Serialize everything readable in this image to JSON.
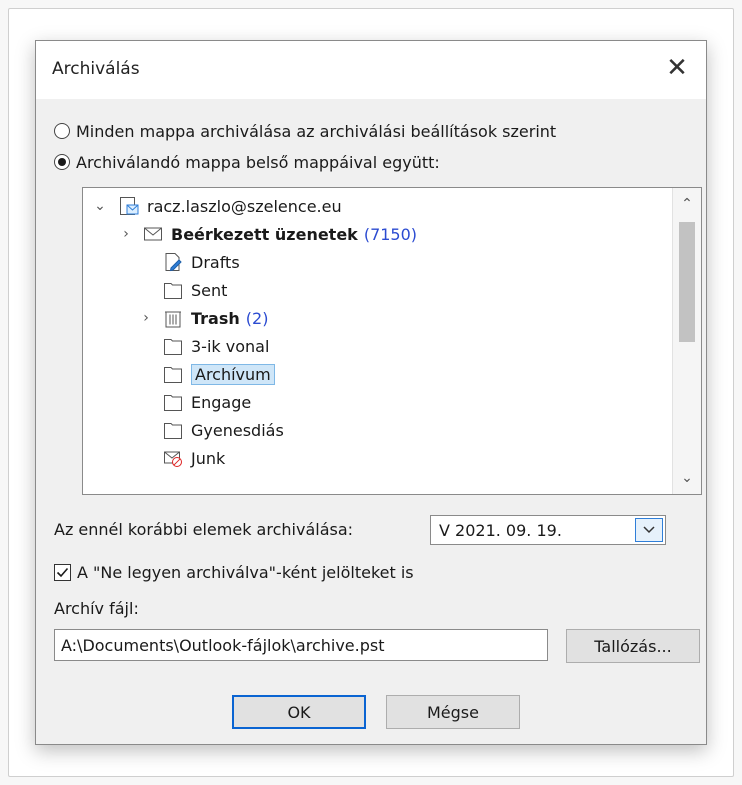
{
  "dialog": {
    "title": "Archiválás",
    "close_glyph": "✕"
  },
  "options": {
    "all_folders_label": "Minden mappa archiválása az archiválási beállítások szerint",
    "all_folders_selected": false,
    "selected_folder_label": "Archiválandó mappa belső mappáival együtt:",
    "selected_folder_selected": true
  },
  "tree": {
    "items": [
      {
        "label": "racz.laszlo@szelence.eu",
        "icon": "account-icon",
        "expander": "expanded",
        "bold": false,
        "count": ""
      },
      {
        "label": "Beérkezett üzenetek",
        "icon": "inbox-icon",
        "expander": "collapsed",
        "bold": true,
        "count": "(7150)"
      },
      {
        "label": "Drafts",
        "icon": "drafts-icon",
        "expander": "",
        "bold": false,
        "count": ""
      },
      {
        "label": "Sent",
        "icon": "folder-icon",
        "expander": "",
        "bold": false,
        "count": ""
      },
      {
        "label": "Trash",
        "icon": "trash-icon",
        "expander": "collapsed",
        "bold": true,
        "count": "(2)"
      },
      {
        "label": "3-ik vonal",
        "icon": "folder-icon",
        "expander": "",
        "bold": false,
        "count": ""
      },
      {
        "label": "Archívum",
        "icon": "folder-icon",
        "expander": "",
        "bold": false,
        "count": "",
        "selected": true
      },
      {
        "label": "Engage",
        "icon": "folder-icon",
        "expander": "",
        "bold": false,
        "count": ""
      },
      {
        "label": "Gyenesdiás",
        "icon": "folder-icon",
        "expander": "",
        "bold": false,
        "count": ""
      },
      {
        "label": "Junk",
        "icon": "junk-icon",
        "expander": "",
        "bold": false,
        "count": ""
      }
    ],
    "scroll_up_glyph": "⌃",
    "scroll_down_glyph": "⌄"
  },
  "archive_before": {
    "label": "Az ennél korábbi elemek archiválása:",
    "value": "V 2021. 09. 19."
  },
  "include_do_not_archive": {
    "label": "A \"Ne legyen archiválva\"-ként jelölteket is",
    "checked": true
  },
  "archive_file": {
    "label": "Archív fájl:",
    "value": "A:\\Documents\\Outlook-fájlok\\archive.pst"
  },
  "buttons": {
    "browse": "Tallózás...",
    "ok": "OK",
    "cancel": "Mégse"
  },
  "colors": {
    "accent": "#0a64d2",
    "count_blue": "#2b4bd1",
    "selection_bg": "#cfe6f8"
  }
}
